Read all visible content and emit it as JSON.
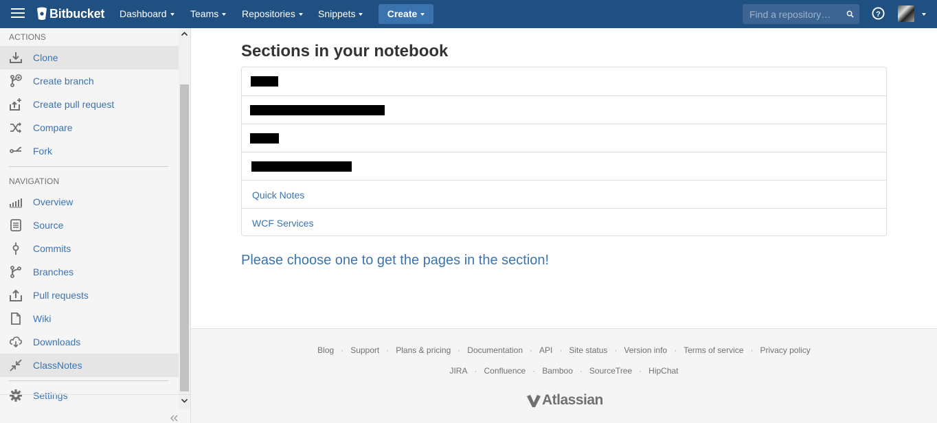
{
  "brand": {
    "name": "Bitbucket"
  },
  "topnav": {
    "items": [
      {
        "label": "Dashboard"
      },
      {
        "label": "Teams"
      },
      {
        "label": "Repositories"
      },
      {
        "label": "Snippets"
      }
    ],
    "create_label": "Create",
    "search_placeholder": "Find a repository…"
  },
  "sidebar": {
    "actions_heading": "ACTIONS",
    "actions": [
      {
        "label": "Clone",
        "icon": "download-icon",
        "active": true
      },
      {
        "label": "Create branch",
        "icon": "branch-add-icon"
      },
      {
        "label": "Create pull request",
        "icon": "pull-request-add-icon"
      },
      {
        "label": "Compare",
        "icon": "shuffle-icon"
      },
      {
        "label": "Fork",
        "icon": "fork-icon"
      }
    ],
    "navigation_heading": "NAVIGATION",
    "navigation": [
      {
        "label": "Overview",
        "icon": "bar-chart-icon"
      },
      {
        "label": "Source",
        "icon": "document-icon"
      },
      {
        "label": "Commits",
        "icon": "commit-icon"
      },
      {
        "label": "Branches",
        "icon": "branch-icon"
      },
      {
        "label": "Pull requests",
        "icon": "pull-request-icon"
      },
      {
        "label": "Wiki",
        "icon": "page-icon"
      },
      {
        "label": "Downloads",
        "icon": "cloud-download-icon"
      },
      {
        "label": "ClassNotes",
        "icon": "collapse-arrows-icon",
        "active": true
      }
    ],
    "settings_label": "Settings"
  },
  "main": {
    "title": "Sections in your notebook",
    "sections": [
      {
        "label": "",
        "redacted": true
      },
      {
        "label": "",
        "redacted": true
      },
      {
        "label": "",
        "redacted": true
      },
      {
        "label": "",
        "redacted": true
      },
      {
        "label": "Quick Notes"
      },
      {
        "label": "WCF Services"
      }
    ],
    "choose_message": "Please choose one to get the pages in the section!"
  },
  "footer": {
    "row1": [
      "Blog",
      "Support",
      "Plans & pricing",
      "Documentation",
      "API",
      "Site status",
      "Version info",
      "Terms of service",
      "Privacy policy"
    ],
    "row2": [
      "JIRA",
      "Confluence",
      "Bamboo",
      "SourceTree",
      "HipChat"
    ],
    "brand": "Atlassian"
  },
  "colors": {
    "header_bg": "#205081",
    "link": "#3b73af",
    "create_button": "#3b73af"
  }
}
